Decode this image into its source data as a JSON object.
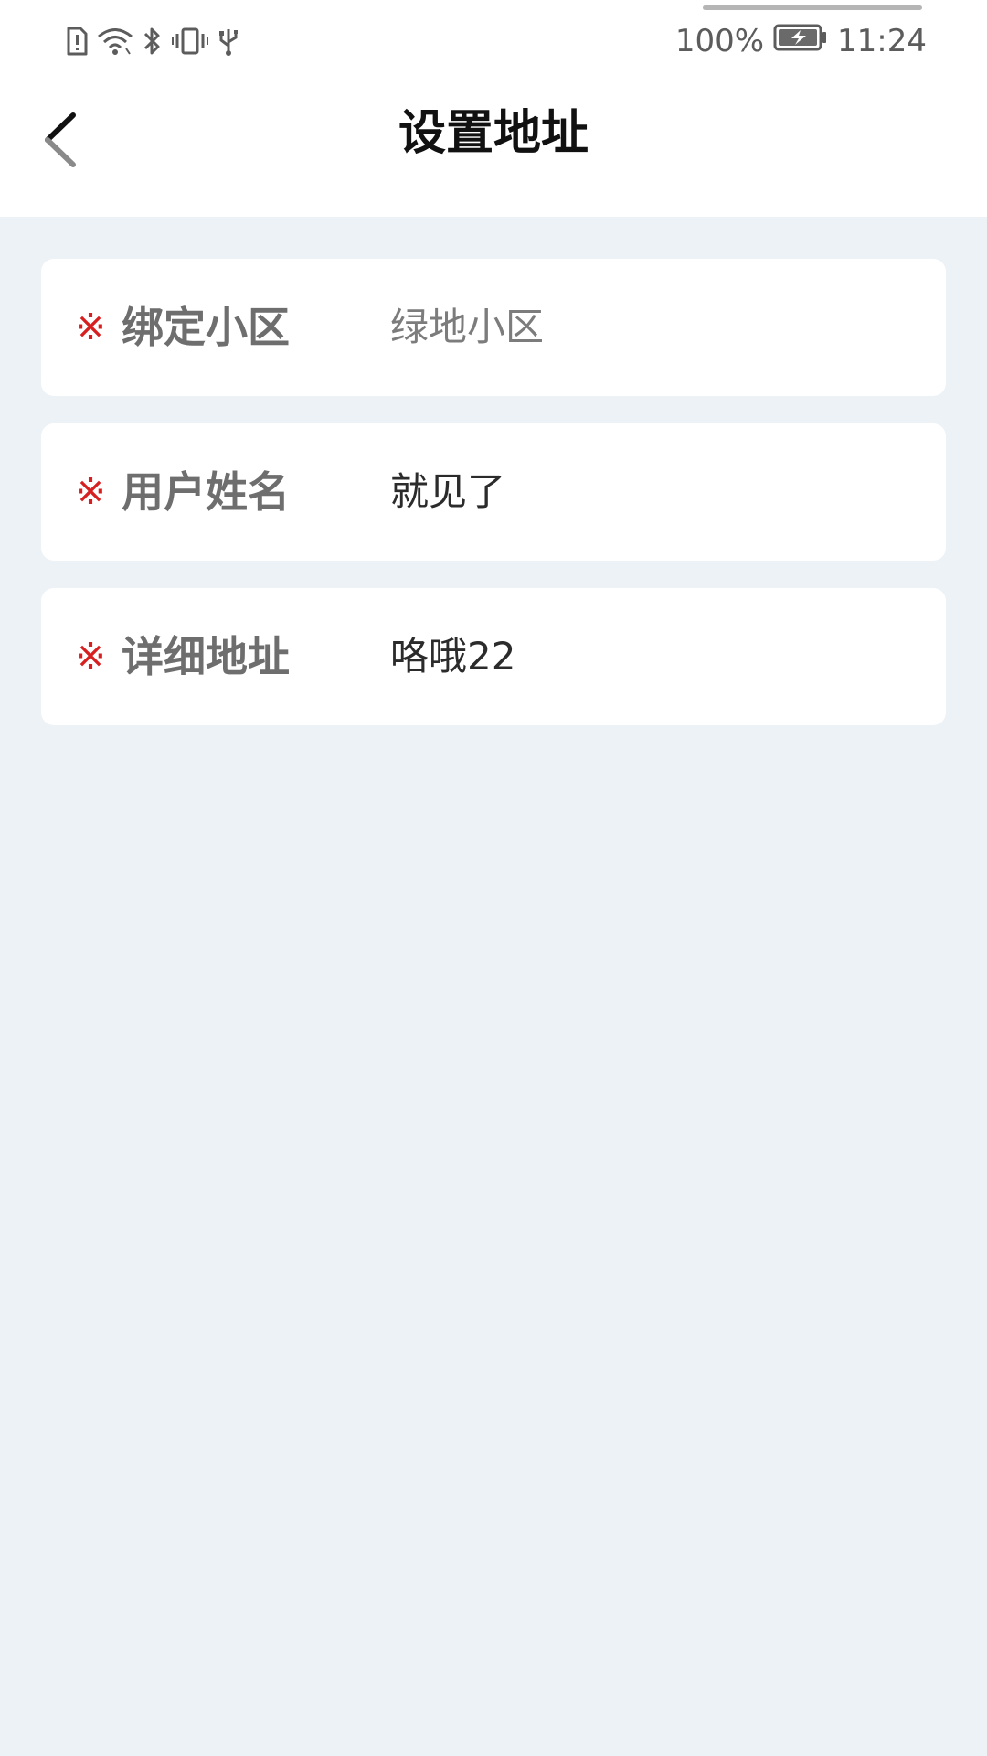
{
  "status_bar": {
    "battery_percent": "100%",
    "time": "11:24",
    "icons": [
      "sim-alert-icon",
      "wifi-icon",
      "bluetooth-icon",
      "vibrate-icon",
      "usb-icon",
      "battery-charging-icon"
    ]
  },
  "nav": {
    "title": "设置地址",
    "back_icon": "chevron-left-icon"
  },
  "form": {
    "required_symbol": "※",
    "fields": [
      {
        "label": "绑定小区",
        "value": "绿地小区",
        "selector": true
      },
      {
        "label": "用户姓名",
        "value": "就见了"
      },
      {
        "label": "详细地址",
        "value": "咯哦22"
      }
    ]
  },
  "colors": {
    "background": "#edf2f6",
    "card": "#ffffff",
    "required": "#d71f1f",
    "label": "#6e6e6e",
    "title": "#111111"
  }
}
